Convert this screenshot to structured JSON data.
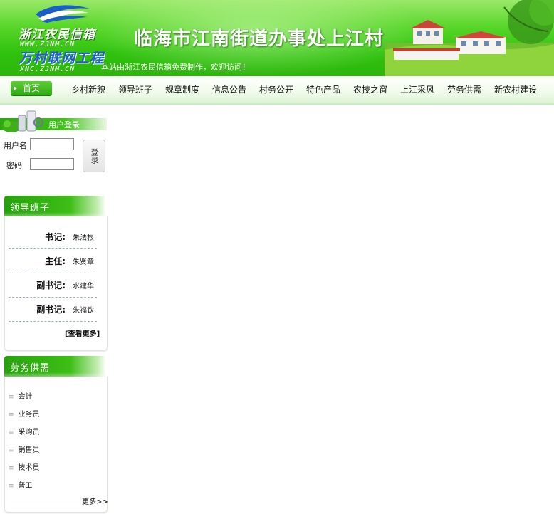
{
  "header": {
    "logo_line1": "浙江农民信箱",
    "logo_line2": "WWW.ZJNM.CN",
    "logo_line3": "万村联网工程",
    "logo_line4": "XNC.ZJNM.CN",
    "title": "临海市江南街道办事处上江村",
    "subtitle": "本站由浙江农民信箱免费制作，欢迎访问！"
  },
  "nav": {
    "home": "首页",
    "items": [
      "乡村新貌",
      "领导班子",
      "规章制度",
      "信息公告",
      "村务公开",
      "特色产品",
      "农技之窗",
      "上江采风",
      "劳务供需",
      "新农村建设"
    ]
  },
  "login": {
    "title": "用户登录",
    "username_label": "用户名",
    "password_label": "密码",
    "username_value": "",
    "password_value": "",
    "button": "登录"
  },
  "leaders": {
    "title": "领导班子",
    "rows": [
      {
        "role": "书记:",
        "name": "朱法根"
      },
      {
        "role": "主任:",
        "name": "朱贤章"
      },
      {
        "role": "副书记:",
        "name": "水建华"
      },
      {
        "role": "副书记:",
        "name": "朱福钦"
      }
    ],
    "more": "[查看更多]"
  },
  "labor": {
    "title": "劳务供需",
    "items": [
      "会计",
      "业务员",
      "采购员",
      "销售员",
      "技术员",
      "普工"
    ],
    "more": "更多>>"
  },
  "colors": {
    "brand_green": "#2fb50c",
    "title_text": "#ffffff",
    "logo_blue": "#1f5fd0"
  }
}
